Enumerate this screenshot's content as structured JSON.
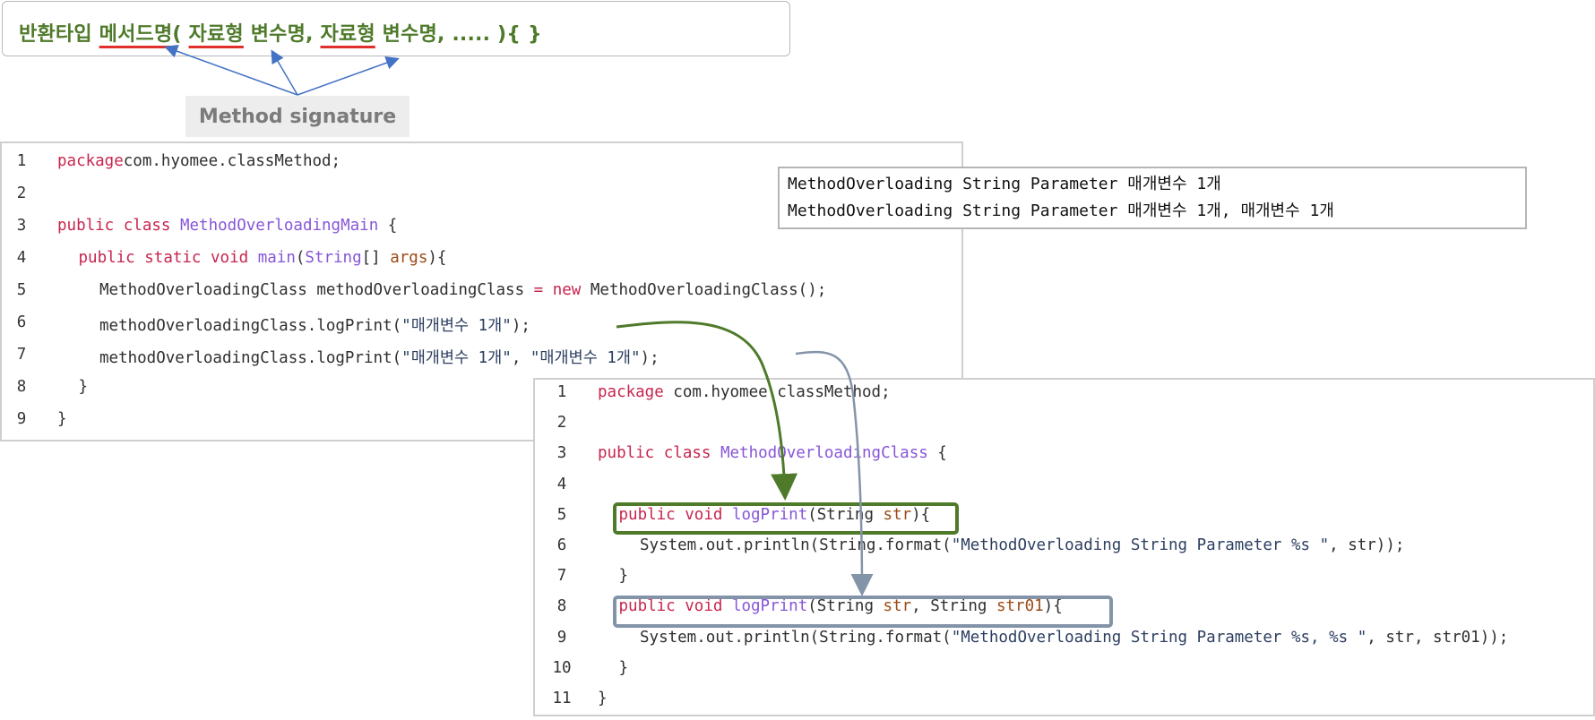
{
  "signature": {
    "parts": [
      {
        "text": "반환타입 ",
        "underline": false
      },
      {
        "text": "메서드명",
        "underline": true
      },
      {
        "text": "( ",
        "underline": false
      },
      {
        "text": "자료형",
        "underline": true
      },
      {
        "text": " 변수명, ",
        "underline": false
      },
      {
        "text": "자료형",
        "underline": true
      },
      {
        "text": " 변수명, ..... ){ }",
        "underline": false
      }
    ],
    "label": "Method signature"
  },
  "main_code": {
    "lines": [
      {
        "n": "1",
        "indent": 0,
        "tokens": [
          [
            "kw",
            "package"
          ],
          [
            "",
            "com.hyomee.classMethod;"
          ]
        ]
      },
      {
        "n": "2",
        "indent": 0,
        "tokens": []
      },
      {
        "n": "3",
        "indent": 0,
        "tokens": [
          [
            "kw",
            "public"
          ],
          [
            "kw",
            " class"
          ],
          [
            "cls",
            " MethodOverloadingMain"
          ],
          [
            "",
            " {"
          ]
        ]
      },
      {
        "n": "4",
        "indent": 1,
        "tokens": [
          [
            "kw",
            "public"
          ],
          [
            "kw",
            " static"
          ],
          [
            "kw",
            " void"
          ],
          [
            "fn",
            " main"
          ],
          [
            "",
            "("
          ],
          [
            "cls",
            "String"
          ],
          [
            "",
            "[] "
          ],
          [
            "var",
            "args"
          ],
          [
            "",
            "){"
          ]
        ]
      },
      {
        "n": "5",
        "indent": 2,
        "tokens": [
          [
            "",
            "MethodOverloadingClass methodOverloadingClass "
          ],
          [
            "kw",
            "="
          ],
          [
            "kw",
            " new"
          ],
          [
            "",
            " MethodOverloadingClass();"
          ]
        ]
      },
      {
        "n": "6",
        "indent": 2,
        "tokens": [
          [
            "",
            "methodOverloadingClass.logPrint("
          ],
          [
            "str",
            "\"매개변수 1개\""
          ],
          [
            "",
            ");"
          ]
        ]
      },
      {
        "n": "7",
        "indent": 2,
        "tokens": [
          [
            "",
            "methodOverloadingClass.logPrint("
          ],
          [
            "str",
            "\"매개변수 1개\""
          ],
          [
            "",
            ", "
          ],
          [
            "str",
            "\"매개변수 1개\""
          ],
          [
            "",
            ");"
          ]
        ]
      },
      {
        "n": "8",
        "indent": 1,
        "tokens": [
          [
            "",
            "}"
          ]
        ]
      },
      {
        "n": "9",
        "indent": 0,
        "tokens": [
          [
            "",
            "}"
          ]
        ]
      }
    ]
  },
  "output": {
    "lines": [
      "MethodOverloading String Parameter 매개변수 1개",
      "MethodOverloading String Parameter 매개변수 1개, 매개변수 1개"
    ]
  },
  "class_code": {
    "lines": [
      {
        "n": "1",
        "indent": 0,
        "tokens": [
          [
            "kw",
            "package"
          ],
          [
            "",
            " com.hyomee.classMethod;"
          ]
        ]
      },
      {
        "n": "2",
        "indent": 0,
        "tokens": []
      },
      {
        "n": "3",
        "indent": 0,
        "tokens": [
          [
            "kw",
            "public"
          ],
          [
            "kw",
            " class"
          ],
          [
            "cls",
            " MethodOverloadingClass"
          ],
          [
            "",
            " {"
          ]
        ]
      },
      {
        "n": "4",
        "indent": 0,
        "tokens": []
      },
      {
        "n": "5",
        "indent": 1,
        "tokens": [
          [
            "kw",
            "public"
          ],
          [
            "kw",
            " void"
          ],
          [
            "fn",
            " logPrint"
          ],
          [
            "",
            "(String "
          ],
          [
            "var",
            "str"
          ],
          [
            "",
            "){"
          ]
        ]
      },
      {
        "n": "6",
        "indent": 2,
        "tokens": [
          [
            "",
            "System.out.println(String.format("
          ],
          [
            "str",
            "\"MethodOverloading String Parameter %s \""
          ],
          [
            "",
            ", str));"
          ]
        ]
      },
      {
        "n": "7",
        "indent": 1,
        "tokens": [
          [
            "",
            "}"
          ]
        ]
      },
      {
        "n": "8",
        "indent": 1,
        "tokens": [
          [
            "kw",
            "public"
          ],
          [
            "kw",
            " void"
          ],
          [
            "fn",
            " logPrint"
          ],
          [
            "",
            "(String "
          ],
          [
            "var",
            "str"
          ],
          [
            "",
            ", String "
          ],
          [
            "var",
            "str01"
          ],
          [
            "",
            "){"
          ]
        ]
      },
      {
        "n": "9",
        "indent": 2,
        "tokens": [
          [
            "",
            "System.out.println(String.format("
          ],
          [
            "str",
            "\"MethodOverloading String Parameter %s, %s \""
          ],
          [
            "",
            ", str, str01));"
          ]
        ]
      },
      {
        "n": "10",
        "indent": 1,
        "tokens": [
          [
            "",
            "}"
          ]
        ]
      },
      {
        "n": "11",
        "indent": 0,
        "tokens": [
          [
            "",
            "}"
          ]
        ]
      }
    ]
  },
  "colors": {
    "signature_text": "#4e7a2a",
    "underline": "#e0302c",
    "pointer_arrows": "#4472c4",
    "green_highlight": "#4e7a2a",
    "grey_highlight": "#8494a8"
  }
}
